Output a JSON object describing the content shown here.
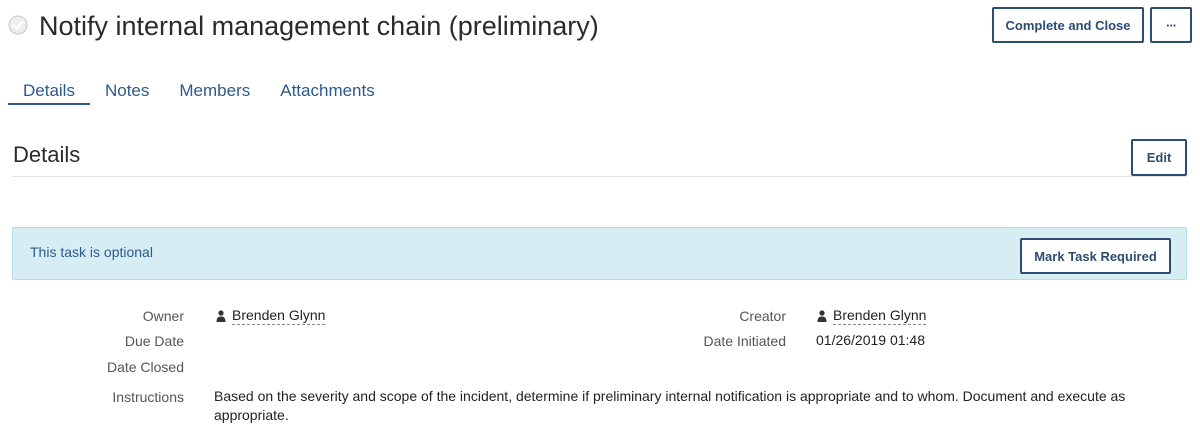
{
  "header": {
    "title": "Notify internal management chain (preliminary)",
    "complete_button": "Complete and Close",
    "more_button": "···"
  },
  "tabs": [
    {
      "label": "Details",
      "active": true
    },
    {
      "label": "Notes",
      "active": false
    },
    {
      "label": "Members",
      "active": false
    },
    {
      "label": "Attachments",
      "active": false
    }
  ],
  "details": {
    "section_title": "Details",
    "edit_button": "Edit",
    "banner": {
      "text": "This task is optional",
      "button": "Mark Task Required"
    },
    "fields": {
      "owner_label": "Owner",
      "owner_value": "Brenden Glynn",
      "due_date_label": "Due Date",
      "date_closed_label": "Date Closed",
      "creator_label": "Creator",
      "creator_value": "Brenden Glynn",
      "date_initiated_label": "Date Initiated",
      "date_initiated_value": "01/26/2019 01:48",
      "instructions_label": "Instructions",
      "instructions_value": "Based on the severity and scope of the incident, determine if preliminary internal notification is appropriate and to whom. Document and execute as appropriate."
    }
  },
  "colors": {
    "accent": "#2d4c73",
    "link": "#2d5a8c",
    "banner_bg": "#d6edf4"
  }
}
